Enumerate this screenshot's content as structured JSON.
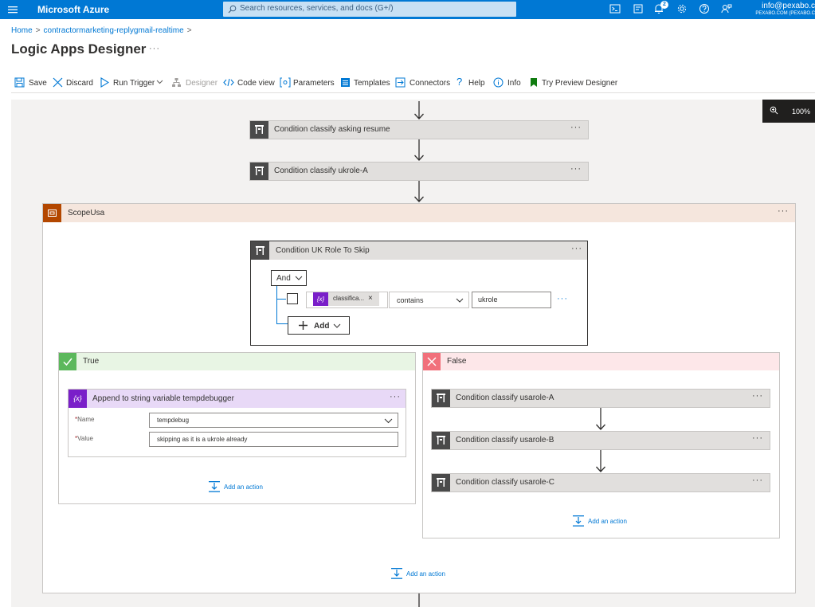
{
  "topbar": {
    "brand": "Microsoft Azure",
    "search_placeholder": "Search resources, services, and docs (G+/)",
    "notification_count": "2",
    "account_email": "info@pexabo.c",
    "account_directory": "PEXABO.COM (PEXABO.C"
  },
  "breadcrumb": {
    "home": "Home",
    "resource": "contractormarketing-replygmail-realtime"
  },
  "page": {
    "title": "Logic Apps Designer",
    "more": "···"
  },
  "toolbar": {
    "save": "Save",
    "discard": "Discard",
    "run_trigger": "Run Trigger",
    "designer": "Designer",
    "code_view": "Code view",
    "parameters": "Parameters",
    "templates": "Templates",
    "connectors": "Connectors",
    "help": "Help",
    "info": "Info",
    "try_preview": "Try Preview Designer"
  },
  "zoom": {
    "level": "100%"
  },
  "steps": {
    "step1": "Condition classify asking resume",
    "step2": "Condition classify ukrole-A",
    "more": "···"
  },
  "scope": {
    "title": "ScopeUsa",
    "more": "···"
  },
  "condition": {
    "title": "Condition UK Role To Skip",
    "more": "···",
    "operator_group": "And",
    "token_label": "classifica...",
    "token_remove": "×",
    "token_icon": "{x}",
    "comparison": "contains",
    "value": "ukrole",
    "row_more": "···",
    "add_label": "Add"
  },
  "true_branch": {
    "title": "True",
    "append": {
      "icon": "{x}",
      "title": "Append to string variable tempdebugger",
      "more": "···",
      "name_label": "Name",
      "name_value": "tempdebug",
      "value_label": "Value",
      "value_value": "skipping as it is a ukrole already",
      "required_mark": "*"
    },
    "add_action": "Add an action"
  },
  "false_branch": {
    "title": "False",
    "steps": [
      "Condition classify usarole-A",
      "Condition classify usarole-B",
      "Condition classify usarole-C"
    ],
    "more": "···",
    "add_action": "Add an action"
  },
  "scope_add_action": "Add an action",
  "colors": {
    "azure_blue": "#0078d4",
    "scope_accent": "#b34700",
    "variable_purple": "#7a1fc9",
    "true_green": "#5cb85c",
    "false_red": "#f1707b"
  }
}
